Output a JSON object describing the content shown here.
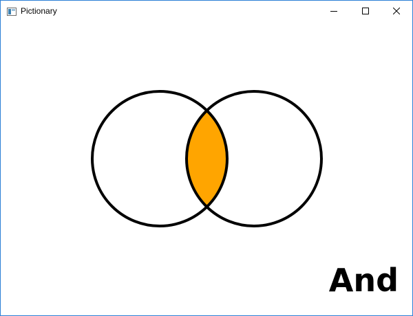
{
  "window": {
    "title": "Pictionary",
    "icon": "app-window-icon",
    "controls": {
      "minimize": "minimize-icon",
      "maximize": "maximize-icon",
      "close": "close-icon"
    }
  },
  "drawing": {
    "caption": "And",
    "highlight_color": "#FFA500",
    "stroke_color": "#000000"
  }
}
